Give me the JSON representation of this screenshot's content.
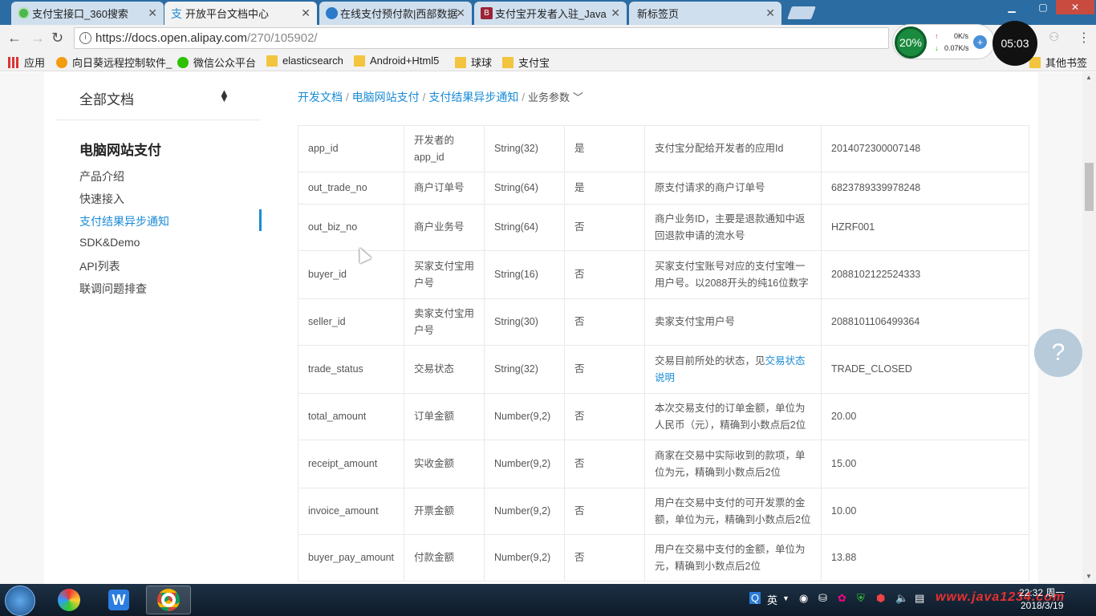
{
  "tabs": [
    {
      "title": "支付宝接口_360搜索",
      "active": false
    },
    {
      "title": "开放平台文档中心",
      "active": true
    },
    {
      "title": "在线支付预付款|西部数据",
      "active": false
    },
    {
      "title": "支付宝开发者入驻_Java",
      "active": false
    },
    {
      "title": "新标签页",
      "active": false
    }
  ],
  "address": {
    "host": "https://docs.open.alipay.com",
    "path": "/270/105902/"
  },
  "bookmarks": [
    {
      "label": "应用",
      "icon": "apps-grid-icon"
    },
    {
      "label": "向日葵远程控制软件_",
      "icon": "sunflower-icon"
    },
    {
      "label": "微信公众平台",
      "icon": "wechat-icon"
    },
    {
      "label": "elasticsearch",
      "icon": "folder-icon"
    },
    {
      "label": "Android+Html5",
      "icon": "folder-icon"
    },
    {
      "label": "球球",
      "icon": "folder-icon"
    },
    {
      "label": "支付宝",
      "icon": "folder-icon"
    }
  ],
  "other_bookmarks": "其他书签",
  "net_widget": {
    "percent": "20%",
    "up": "0K/s",
    "down": "0.07K/s"
  },
  "clock_widget": "05:03",
  "sidebar": {
    "all_docs": "全部文档",
    "section_title": "电脑网站支付",
    "items": [
      "产品介绍",
      "快速接入",
      "支付结果异步通知",
      "SDK&Demo",
      "API列表",
      "联调问题排查"
    ],
    "active_index": 2
  },
  "breadcrumb": {
    "items": [
      "开发文档",
      "电脑网站支付",
      "支付结果异步通知"
    ],
    "current": "业务参数"
  },
  "table": {
    "rows": [
      {
        "name": "app_id",
        "desc": "开发者的app_id",
        "type": "String(32)",
        "required": "是",
        "explain": "支付宝分配给开发者的应用Id",
        "example": "2014072300007148"
      },
      {
        "name": "out_trade_no",
        "desc": "商户订单号",
        "type": "String(64)",
        "required": "是",
        "explain": "原支付请求的商户订单号",
        "example": "6823789339978248"
      },
      {
        "name": "out_biz_no",
        "desc": "商户业务号",
        "type": "String(64)",
        "required": "否",
        "explain": "商户业务ID，主要是退款通知中返回退款申请的流水号",
        "example": "HZRF001"
      },
      {
        "name": "buyer_id",
        "desc": "买家支付宝用户号",
        "type": "String(16)",
        "required": "否",
        "explain": "买家支付宝账号对应的支付宝唯一用户号。以2088开头的纯16位数字",
        "example": "2088102122524333"
      },
      {
        "name": "seller_id",
        "desc": "卖家支付宝用户号",
        "type": "String(30)",
        "required": "否",
        "explain": "卖家支付宝用户号",
        "example": "2088101106499364"
      },
      {
        "name": "trade_status",
        "desc": "交易状态",
        "type": "String(32)",
        "required": "否",
        "explain": "交易目前所处的状态，见",
        "explain_link": "交易状态说明",
        "example": "TRADE_CLOSED"
      },
      {
        "name": "total_amount",
        "desc": "订单金额",
        "type": "Number(9,2)",
        "required": "否",
        "explain": "本次交易支付的订单金额，单位为人民币（元），精确到小数点后2位",
        "example": "20.00"
      },
      {
        "name": "receipt_amount",
        "desc": "实收金额",
        "type": "Number(9,2)",
        "required": "否",
        "explain": "商家在交易中实际收到的款项，单位为元，精确到小数点后2位",
        "example": "15.00"
      },
      {
        "name": "invoice_amount",
        "desc": "开票金额",
        "type": "Number(9,2)",
        "required": "否",
        "explain": "用户在交易中支付的可开发票的金额，单位为元，精确到小数点后2位",
        "example": "10.00"
      },
      {
        "name": "buyer_pay_amount",
        "desc": "付款金额",
        "type": "Number(9,2)",
        "required": "否",
        "explain": "用户在交易中支付的金额，单位为元，精确到小数点后2位",
        "example": "13.88"
      }
    ]
  },
  "help_label": "?",
  "taskbar": {
    "ime": "英",
    "time": "22:32 周一",
    "date": "2018/3/19",
    "watermark": "www.java1234.com"
  },
  "colors": {
    "accent": "#1a8bd6",
    "tab_bar": "#2b6ca3"
  }
}
